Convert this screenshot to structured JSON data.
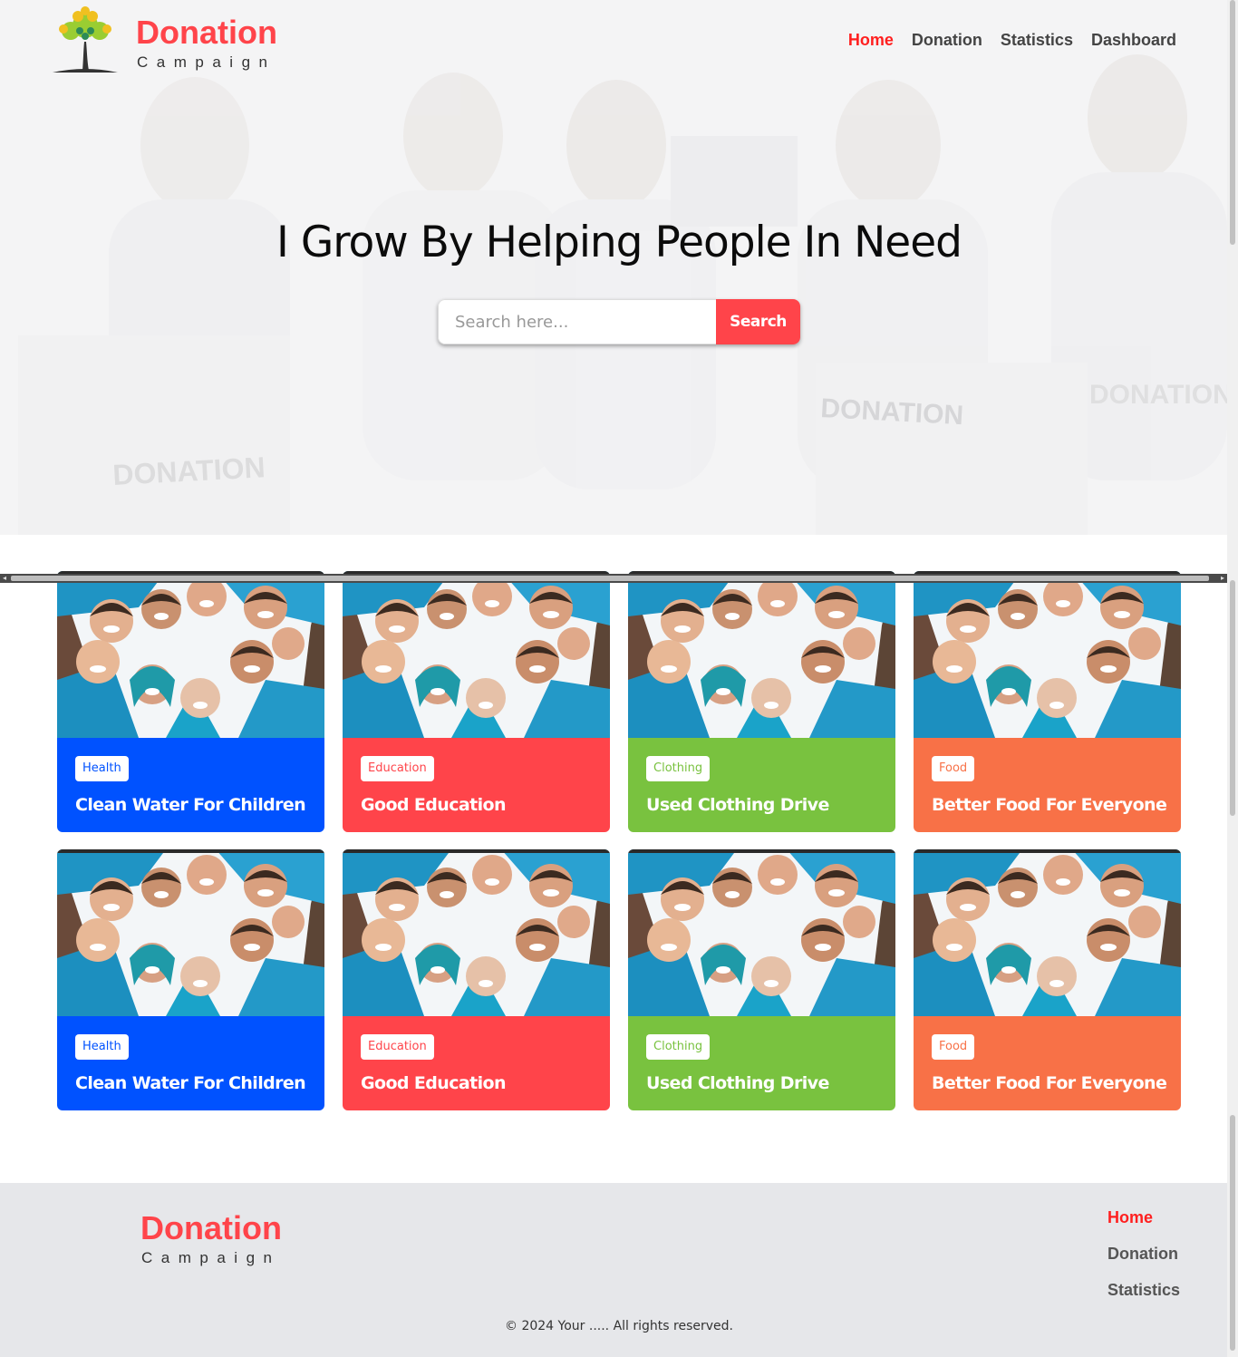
{
  "brand": {
    "title": "Donation",
    "subtitle": "Campaign"
  },
  "nav": {
    "items": [
      {
        "label": "Home",
        "active": true
      },
      {
        "label": "Donation",
        "active": false
      },
      {
        "label": "Statistics",
        "active": false
      },
      {
        "label": "Dashboard",
        "active": false
      }
    ]
  },
  "hero": {
    "title": "I Grow By Helping People In Need",
    "search_placeholder": "Search here...",
    "search_button": "Search",
    "bg_sign_text": "DONATION"
  },
  "cards": [
    {
      "category": "Health",
      "title": "Clean Water For Children",
      "bg": "#0052ff",
      "badge_color": "#0052ff"
    },
    {
      "category": "Education",
      "title": "Good Education",
      "bg": "#ff444a",
      "badge_color": "#ff444a"
    },
    {
      "category": "Clothing",
      "title": "Used Clothing Drive",
      "bg": "#79c23f",
      "badge_color": "#79c23f"
    },
    {
      "category": "Food",
      "title": "Better Food For Everyone",
      "bg": "#f87147",
      "badge_color": "#f87147"
    },
    {
      "category": "Health",
      "title": "Clean Water For Children",
      "bg": "#0052ff",
      "badge_color": "#0052ff"
    },
    {
      "category": "Education",
      "title": "Good Education",
      "bg": "#ff444a",
      "badge_color": "#ff444a"
    },
    {
      "category": "Clothing",
      "title": "Used Clothing Drive",
      "bg": "#79c23f",
      "badge_color": "#79c23f"
    },
    {
      "category": "Food",
      "title": "Better Food For Everyone",
      "bg": "#f87147",
      "badge_color": "#f87147"
    }
  ],
  "footer": {
    "title": "Donation",
    "subtitle": "Campaign",
    "nav": [
      {
        "label": "Home",
        "active": true
      },
      {
        "label": "Donation",
        "active": false
      },
      {
        "label": "Statistics",
        "active": false
      }
    ],
    "copyright": "© 2024 Your ..... All rights reserved."
  },
  "colors": {
    "accent": "#ff444a",
    "active_link": "#ff1f1f",
    "footer_bg": "#e6e7ea"
  }
}
